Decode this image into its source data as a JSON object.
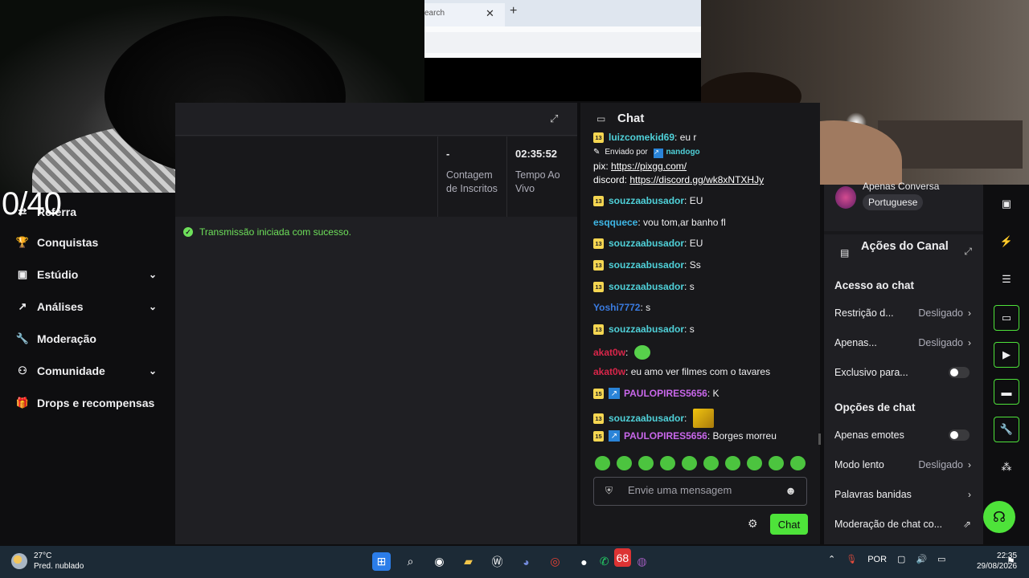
{
  "overlay": {
    "counter": "0/40"
  },
  "browser": {
    "tab_text": "earch",
    "close_glyph": "✕",
    "new_tab_glyph": "+"
  },
  "sidebar": {
    "items": [
      {
        "label": "Referra",
        "icon": "referral-icon",
        "chevron": false
      },
      {
        "label": "Conquistas",
        "icon": "trophy-icon",
        "chevron": false
      },
      {
        "label": "Estúdio",
        "icon": "studio-icon",
        "chevron": true
      },
      {
        "label": "Análises",
        "icon": "analytics-icon",
        "chevron": true
      },
      {
        "label": "Moderação",
        "icon": "wrench-icon",
        "chevron": false
      },
      {
        "label": "Comunidade",
        "icon": "community-icon",
        "chevron": true
      },
      {
        "label": "Drops e recompensas",
        "icon": "gift-icon",
        "chevron": false
      }
    ]
  },
  "stream_panel": {
    "stats": [
      {
        "value": "-",
        "label": "Contagem de Inscritos"
      },
      {
        "value": "02:35:52",
        "label": "Tempo Ao Vivo"
      }
    ],
    "log_message": "Transmissão iniciada com sucesso."
  },
  "chat": {
    "title": "Chat",
    "top_partial": {
      "user": "luizcomekid69",
      "text": "eu r"
    },
    "pinned": {
      "by_label": "Enviado por",
      "by_user": "nandogo",
      "lines": [
        {
          "label": "pix:",
          "link": "https://pixgg.com/"
        },
        {
          "label": "discord:",
          "link": "https://discord.gg/wk8xNTXHJy"
        }
      ]
    },
    "messages": [
      {
        "badge": "13",
        "user": "souzzaabusador",
        "color": "#4fd0d8",
        "text": "EU",
        "emote": false
      },
      {
        "badge": "",
        "user": "esqquece",
        "color": "#3fb8e8",
        "text": "vou tom,ar banho fl",
        "emote": false
      },
      {
        "badge": "13",
        "user": "souzzaabusador",
        "color": "#4fd0d8",
        "text": "EU",
        "emote": false
      },
      {
        "badge": "13",
        "user": "souzzaabusador",
        "color": "#4fd0d8",
        "text": "Ss",
        "emote": false
      },
      {
        "badge": "13",
        "user": "souzzaabusador",
        "color": "#4fd0d8",
        "text": "s",
        "emote": false
      },
      {
        "badge": "",
        "user": "Yoshi7772",
        "color": "#3a7be0",
        "text": "s",
        "emote": false
      },
      {
        "badge": "13",
        "user": "souzzaabusador",
        "color": "#4fd0d8",
        "text": "s",
        "emote": false
      },
      {
        "badge": "",
        "user": "akat0w",
        "color": "#d9264a",
        "text": "",
        "emote": true
      },
      {
        "badge": "",
        "user": "akat0w",
        "color": "#d9264a",
        "text": "eu amo ver filmes com o tavares",
        "emote": false
      },
      {
        "badge": "15",
        "user": "PAULOPIRES5656",
        "color": "#c867ea",
        "text": "K",
        "emote": false,
        "prime": true
      },
      {
        "badge": "13",
        "user": "souzzaabusador",
        "color": "#4fd0d8",
        "text": "",
        "emote": "img"
      },
      {
        "badge": "15",
        "user": "PAULOPIRES5656",
        "color": "#c867ea",
        "text": "Borges morreu",
        "emote": false,
        "prime": true
      }
    ],
    "input_placeholder": "Envie uma mensagem",
    "send_label": "Chat"
  },
  "right_panel": {
    "conversation": "Apenas Conversa",
    "language": "Portuguese",
    "actions_title": "Ações do Canal",
    "sections": [
      {
        "heading": "Acesso ao chat",
        "options": [
          {
            "label": "Restrição d...",
            "value": "Desligado",
            "type": "arrow"
          },
          {
            "label": "Apenas...",
            "value": "Desligado",
            "type": "arrow"
          },
          {
            "label": "Exclusivo para...",
            "value": "",
            "type": "toggle"
          }
        ]
      },
      {
        "heading": "Opções de chat",
        "options": [
          {
            "label": "Apenas emotes",
            "value": "",
            "type": "toggle"
          },
          {
            "label": "Modo lento",
            "value": "Desligado",
            "type": "arrow"
          },
          {
            "label": "Palavras banidas",
            "value": "",
            "type": "arrow"
          },
          {
            "label": "Moderação de chat co...",
            "value": "",
            "type": "external"
          }
        ]
      }
    ]
  },
  "taskbar": {
    "temp": "27°C",
    "weather": "Pred. nublado",
    "lang": "POR",
    "time": "22:35",
    "date": "29/08/2026",
    "whatsapp_badge": "68"
  },
  "colors": {
    "accent": "#4ee33a",
    "success": "#6ee05a"
  }
}
